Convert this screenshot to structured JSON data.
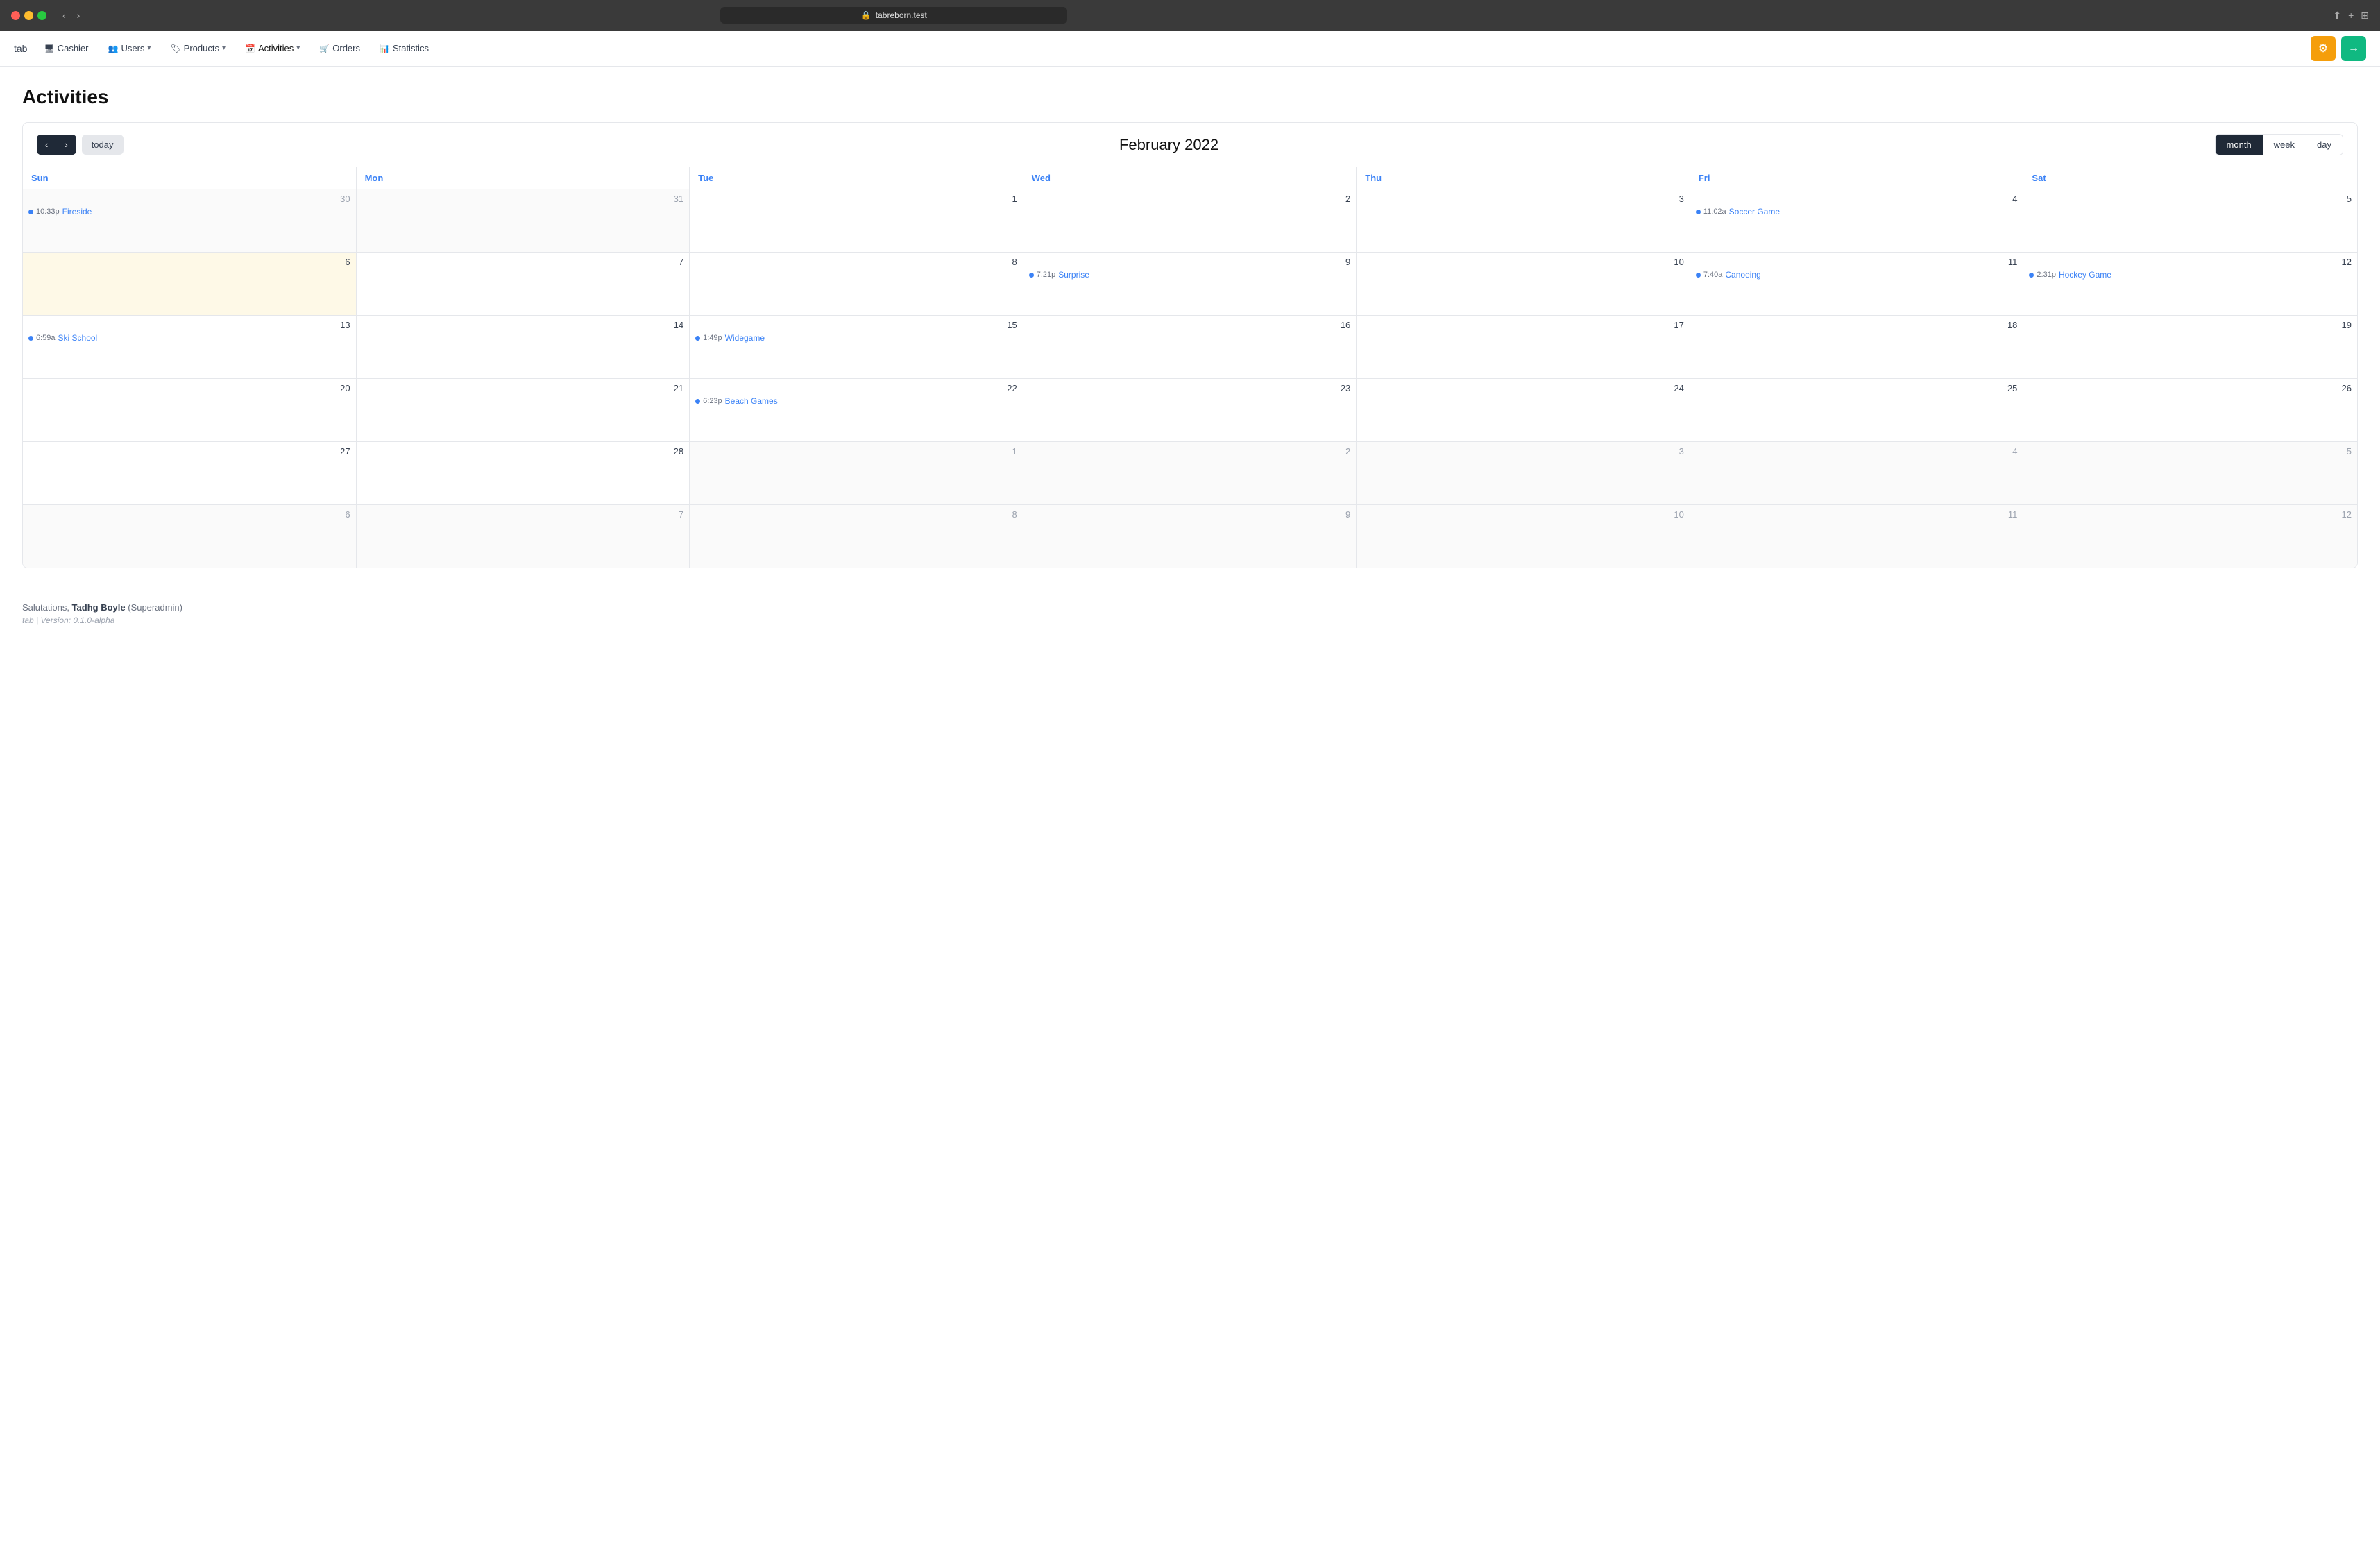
{
  "browser": {
    "url": "tabreborn.test",
    "url_icon": "🔒"
  },
  "nav": {
    "logo": "tab",
    "items": [
      {
        "id": "cashier",
        "label": "Cashier",
        "icon": "🖥",
        "has_dropdown": false
      },
      {
        "id": "users",
        "label": "Users",
        "icon": "👥",
        "has_dropdown": true
      },
      {
        "id": "products",
        "label": "Products",
        "icon": "🏷",
        "has_dropdown": true
      },
      {
        "id": "activities",
        "label": "Activities",
        "icon": "📅",
        "has_dropdown": true,
        "active": true
      },
      {
        "id": "orders",
        "label": "Orders",
        "icon": "🛒",
        "has_dropdown": false
      },
      {
        "id": "statistics",
        "label": "Statistics",
        "icon": "📊",
        "has_dropdown": false
      }
    ],
    "gear_label": "⚙",
    "exit_label": "→"
  },
  "page": {
    "title": "Activities"
  },
  "calendar": {
    "prev_btn": "‹",
    "next_btn": "›",
    "today_btn": "today",
    "month_title": "February 2022",
    "view_buttons": [
      {
        "id": "month",
        "label": "month",
        "active": true
      },
      {
        "id": "week",
        "label": "week",
        "active": false
      },
      {
        "id": "day",
        "label": "day",
        "active": false
      }
    ],
    "day_names": [
      "Sun",
      "Mon",
      "Tue",
      "Wed",
      "Thu",
      "Fri",
      "Sat"
    ],
    "weeks": [
      {
        "days": [
          {
            "date": "30",
            "other_month": true,
            "today": false,
            "events": [
              {
                "time": "10:33p",
                "name": "Fireside"
              }
            ]
          },
          {
            "date": "31",
            "other_month": true,
            "today": false,
            "events": []
          },
          {
            "date": "1",
            "other_month": false,
            "today": false,
            "events": []
          },
          {
            "date": "2",
            "other_month": false,
            "today": false,
            "events": []
          },
          {
            "date": "3",
            "other_month": false,
            "today": false,
            "events": []
          },
          {
            "date": "4",
            "other_month": false,
            "today": false,
            "events": [
              {
                "time": "11:02a",
                "name": "Soccer Game"
              }
            ]
          },
          {
            "date": "5",
            "other_month": false,
            "today": false,
            "events": []
          }
        ]
      },
      {
        "days": [
          {
            "date": "6",
            "other_month": false,
            "today": true,
            "events": []
          },
          {
            "date": "7",
            "other_month": false,
            "today": false,
            "events": []
          },
          {
            "date": "8",
            "other_month": false,
            "today": false,
            "events": []
          },
          {
            "date": "9",
            "other_month": false,
            "today": false,
            "events": [
              {
                "time": "7:21p",
                "name": "Surprise"
              }
            ]
          },
          {
            "date": "10",
            "other_month": false,
            "today": false,
            "events": []
          },
          {
            "date": "11",
            "other_month": false,
            "today": false,
            "events": [
              {
                "time": "7:40a",
                "name": "Canoeing"
              }
            ]
          },
          {
            "date": "12",
            "other_month": false,
            "today": false,
            "events": [
              {
                "time": "2:31p",
                "name": "Hockey Game"
              }
            ]
          }
        ]
      },
      {
        "days": [
          {
            "date": "13",
            "other_month": false,
            "today": false,
            "events": [
              {
                "time": "6:59a",
                "name": "Ski School"
              }
            ]
          },
          {
            "date": "14",
            "other_month": false,
            "today": false,
            "events": []
          },
          {
            "date": "15",
            "other_month": false,
            "today": false,
            "events": [
              {
                "time": "1:49p",
                "name": "Widegame"
              }
            ]
          },
          {
            "date": "16",
            "other_month": false,
            "today": false,
            "events": []
          },
          {
            "date": "17",
            "other_month": false,
            "today": false,
            "events": []
          },
          {
            "date": "18",
            "other_month": false,
            "today": false,
            "events": []
          },
          {
            "date": "19",
            "other_month": false,
            "today": false,
            "events": []
          }
        ]
      },
      {
        "days": [
          {
            "date": "20",
            "other_month": false,
            "today": false,
            "events": []
          },
          {
            "date": "21",
            "other_month": false,
            "today": false,
            "events": []
          },
          {
            "date": "22",
            "other_month": false,
            "today": false,
            "events": [
              {
                "time": "6:23p",
                "name": "Beach Games"
              }
            ]
          },
          {
            "date": "23",
            "other_month": false,
            "today": false,
            "events": []
          },
          {
            "date": "24",
            "other_month": false,
            "today": false,
            "events": []
          },
          {
            "date": "25",
            "other_month": false,
            "today": false,
            "events": []
          },
          {
            "date": "26",
            "other_month": false,
            "today": false,
            "events": []
          }
        ]
      },
      {
        "days": [
          {
            "date": "27",
            "other_month": false,
            "today": false,
            "events": []
          },
          {
            "date": "28",
            "other_month": false,
            "today": false,
            "events": []
          },
          {
            "date": "1",
            "other_month": true,
            "today": false,
            "events": []
          },
          {
            "date": "2",
            "other_month": true,
            "today": false,
            "events": []
          },
          {
            "date": "3",
            "other_month": true,
            "today": false,
            "events": []
          },
          {
            "date": "4",
            "other_month": true,
            "today": false,
            "events": []
          },
          {
            "date": "5",
            "other_month": true,
            "today": false,
            "events": []
          }
        ]
      },
      {
        "days": [
          {
            "date": "6",
            "other_month": true,
            "today": false,
            "events": []
          },
          {
            "date": "7",
            "other_month": true,
            "today": false,
            "events": []
          },
          {
            "date": "8",
            "other_month": true,
            "today": false,
            "events": []
          },
          {
            "date": "9",
            "other_month": true,
            "today": false,
            "events": []
          },
          {
            "date": "10",
            "other_month": true,
            "today": false,
            "events": []
          },
          {
            "date": "11",
            "other_month": true,
            "today": false,
            "events": []
          },
          {
            "date": "12",
            "other_month": true,
            "today": false,
            "events": []
          }
        ]
      }
    ]
  },
  "footer": {
    "greeting_prefix": "Salutations, ",
    "user_name": "Tadhg Boyle",
    "user_role": "(Superadmin)",
    "version_line": "tab | Version: 0.1.0-alpha"
  }
}
